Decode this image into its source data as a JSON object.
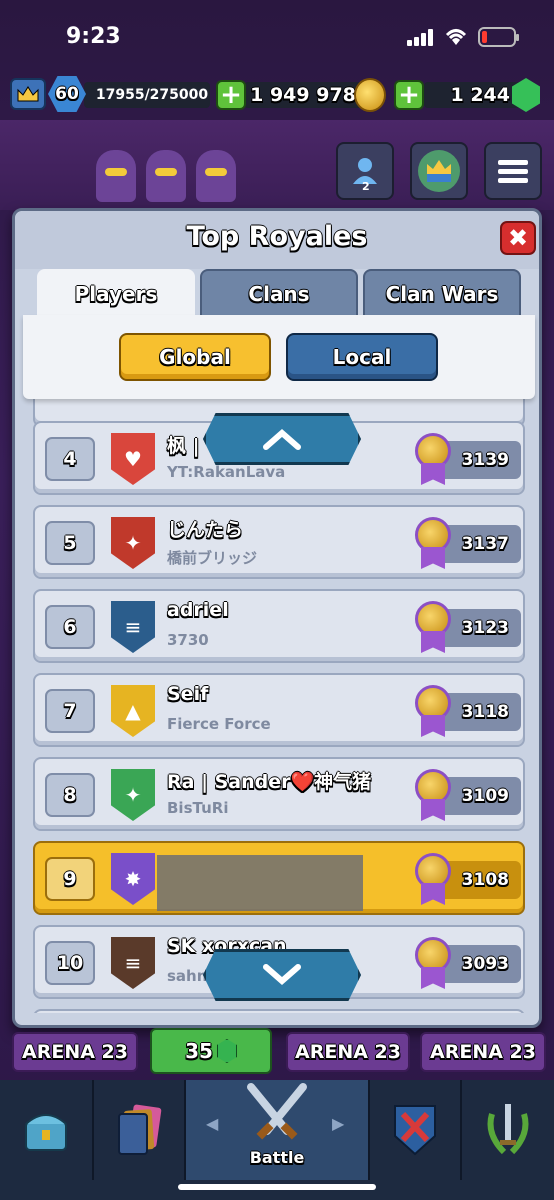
{
  "status_bar": {
    "time": "9:23"
  },
  "resources": {
    "level": "60",
    "xp": "17955/275000",
    "gold": "1 949 978",
    "gems": "1 244",
    "icons": [
      "crown-icon",
      "plus-icon",
      "coin-icon",
      "gem-icon"
    ]
  },
  "top_icons": {
    "friends_count": "2"
  },
  "modal": {
    "title": "Top Royales",
    "close_symbol": "✖",
    "tabs": [
      {
        "label": "Players",
        "active": true
      },
      {
        "label": "Clans",
        "active": false
      },
      {
        "label": "Clan Wars",
        "active": false
      }
    ],
    "filters": [
      {
        "label": "Global",
        "selected": true
      },
      {
        "label": "Local",
        "selected": false
      }
    ]
  },
  "rankings": [
    {
      "rank": "4",
      "name": "枫 |",
      "clan": "YT:RakanLava",
      "trophies": "3139",
      "badge_color": "#d9463c",
      "badge_symbol": "♥",
      "highlight": false
    },
    {
      "rank": "5",
      "name": "じんたら",
      "clan": "橋前ブリッジ",
      "trophies": "3137",
      "badge_color": "#c0392b",
      "badge_symbol": "✦",
      "highlight": false
    },
    {
      "rank": "6",
      "name": "adriel",
      "clan": "3730",
      "trophies": "3123",
      "badge_color": "#2b5d8c",
      "badge_symbol": "≡",
      "highlight": false
    },
    {
      "rank": "7",
      "name": "Seif",
      "clan": "Fierce Force",
      "trophies": "3118",
      "badge_color": "#e6b422",
      "badge_symbol": "▲",
      "highlight": false
    },
    {
      "rank": "8",
      "name": "Ra | Sander❤️神气猪",
      "clan": "BisTuRi",
      "trophies": "3109",
      "badge_color": "#3aa655",
      "badge_symbol": "✦",
      "highlight": false
    },
    {
      "rank": "9",
      "name": "",
      "clan": "",
      "trophies": "3108",
      "badge_color": "#7a4fc9",
      "badge_symbol": "✸",
      "highlight": true
    },
    {
      "rank": "10",
      "name": "SK xorxcan",
      "clan": "sahn",
      "trophies": "3093",
      "badge_color": "#5a3a2a",
      "badge_symbol": "≡",
      "highlight": false
    }
  ],
  "arena": {
    "label": "ARENA 23",
    "gem_reward": "35"
  },
  "bottom_nav": {
    "active_label": "Battle"
  }
}
